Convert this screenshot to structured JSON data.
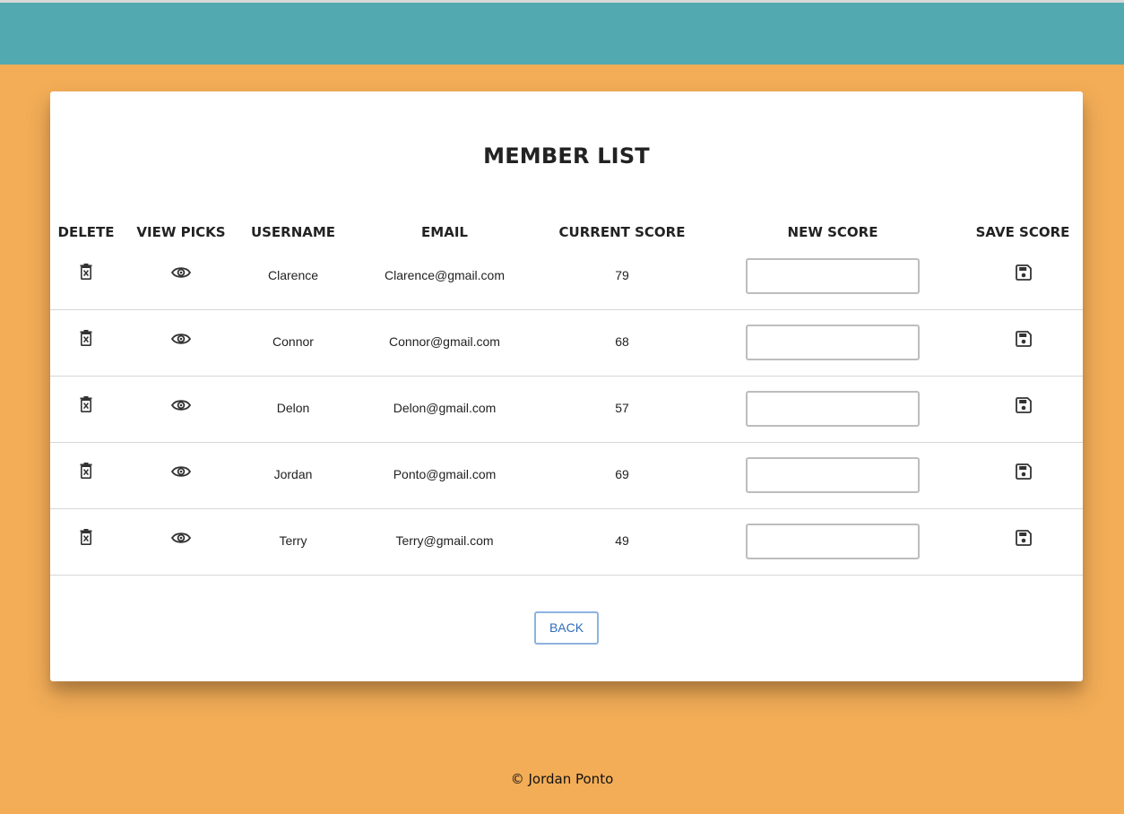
{
  "page": {
    "title": "MEMBER LIST",
    "back_label": "BACK",
    "footer": "© Jordan Ponto"
  },
  "colors": {
    "topbar": "#52A9B0",
    "background": "#F3AD57",
    "card": "#FFFFFF",
    "back_button_text": "#2F6DB8",
    "back_button_border": "#8FB2E0"
  },
  "table": {
    "headers": [
      "DELETE",
      "VIEW PICKS",
      "USERNAME",
      "EMAIL",
      "CURRENT SCORE",
      "NEW SCORE",
      "SAVE SCORE"
    ],
    "icons": {
      "delete": "trash-icon",
      "view": "eye-icon",
      "save": "floppy-disk-icon"
    },
    "rows": [
      {
        "username": "Clarence",
        "email": "Clarence@gmail.com",
        "current_score": "79",
        "new_score": ""
      },
      {
        "username": "Connor",
        "email": "Connor@gmail.com",
        "current_score": "68",
        "new_score": ""
      },
      {
        "username": "Delon",
        "email": "Delon@gmail.com",
        "current_score": "57",
        "new_score": ""
      },
      {
        "username": "Jordan",
        "email": "Ponto@gmail.com",
        "current_score": "69",
        "new_score": ""
      },
      {
        "username": "Terry",
        "email": "Terry@gmail.com",
        "current_score": "49",
        "new_score": ""
      }
    ]
  }
}
